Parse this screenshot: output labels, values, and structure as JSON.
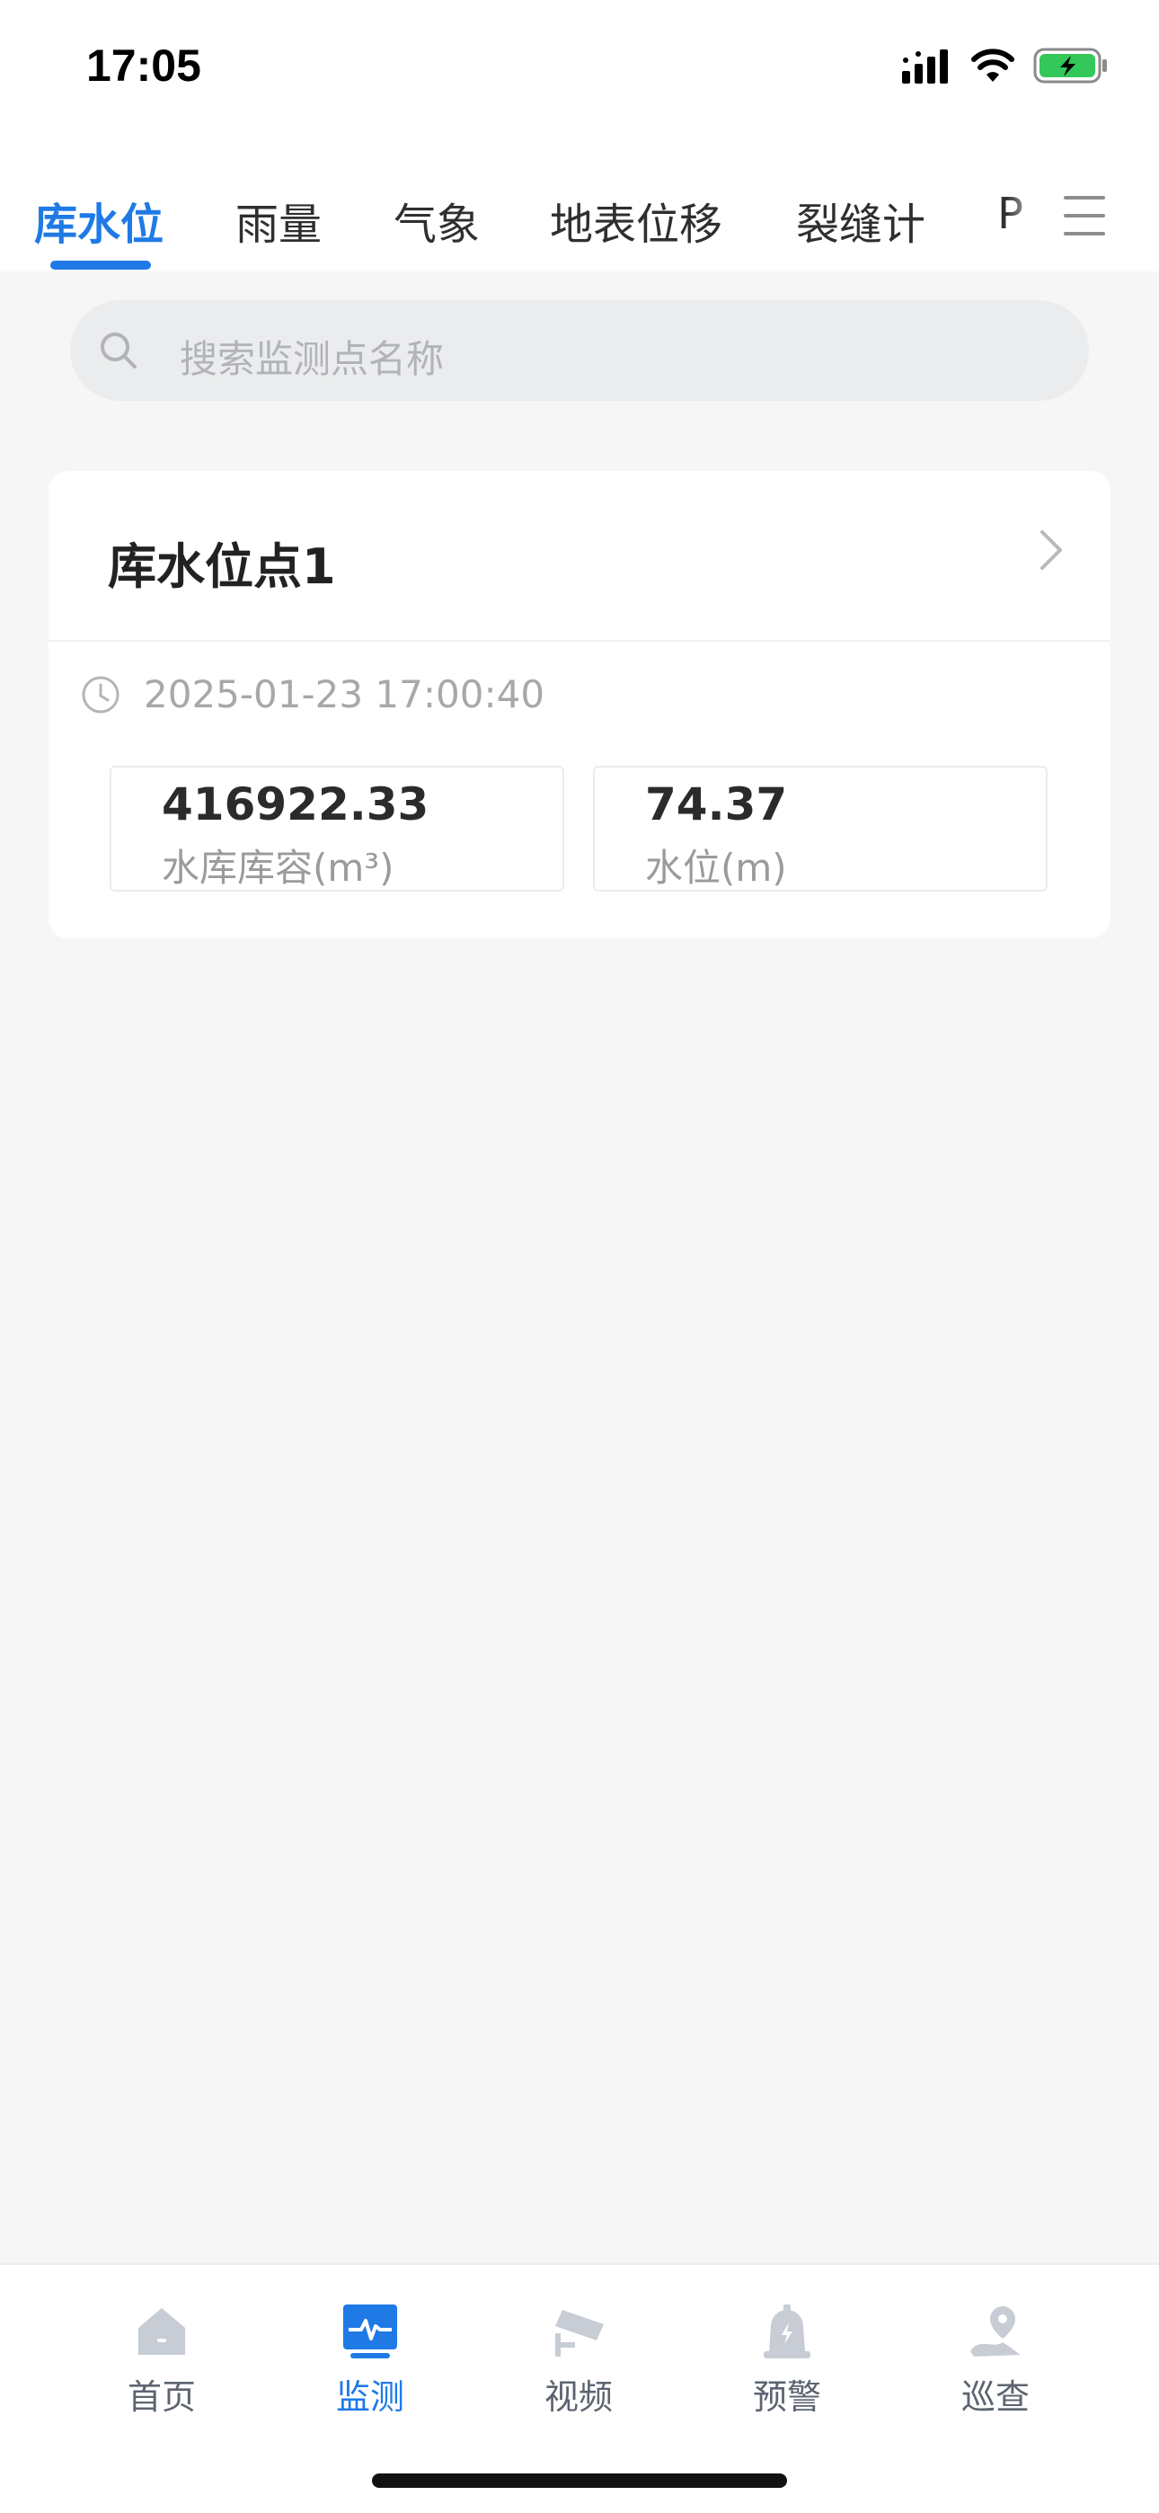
{
  "status_bar": {
    "time": "17:05"
  },
  "tabs": [
    {
      "label": "库水位",
      "active": true
    },
    {
      "label": "雨量",
      "active": false
    },
    {
      "label": "气象",
      "active": false
    },
    {
      "label": "地表位移",
      "active": false
    },
    {
      "label": "裂缝计",
      "active": false
    },
    {
      "label": "P",
      "active": false
    }
  ],
  "search": {
    "placeholder": "搜索监测点名称"
  },
  "card": {
    "title": "库水位点1",
    "timestamp": "2025-01-23 17:00:40",
    "metrics": [
      {
        "value": "416922.33",
        "label": "水库库容(m³)"
      },
      {
        "value": "74.37",
        "label": "水位(m)"
      }
    ]
  },
  "bottom_nav": [
    {
      "label": "首页",
      "icon": "home-icon",
      "active": false
    },
    {
      "label": "监测",
      "icon": "monitor-icon",
      "active": true
    },
    {
      "label": "视频",
      "icon": "camera-icon",
      "active": false
    },
    {
      "label": "预警",
      "icon": "alarm-bell-icon",
      "active": false
    },
    {
      "label": "巡查",
      "icon": "location-pin-icon",
      "active": false
    }
  ],
  "colors": {
    "accent": "#1f7ae6",
    "background": "#f6f6f7",
    "battery": "#34c759"
  }
}
